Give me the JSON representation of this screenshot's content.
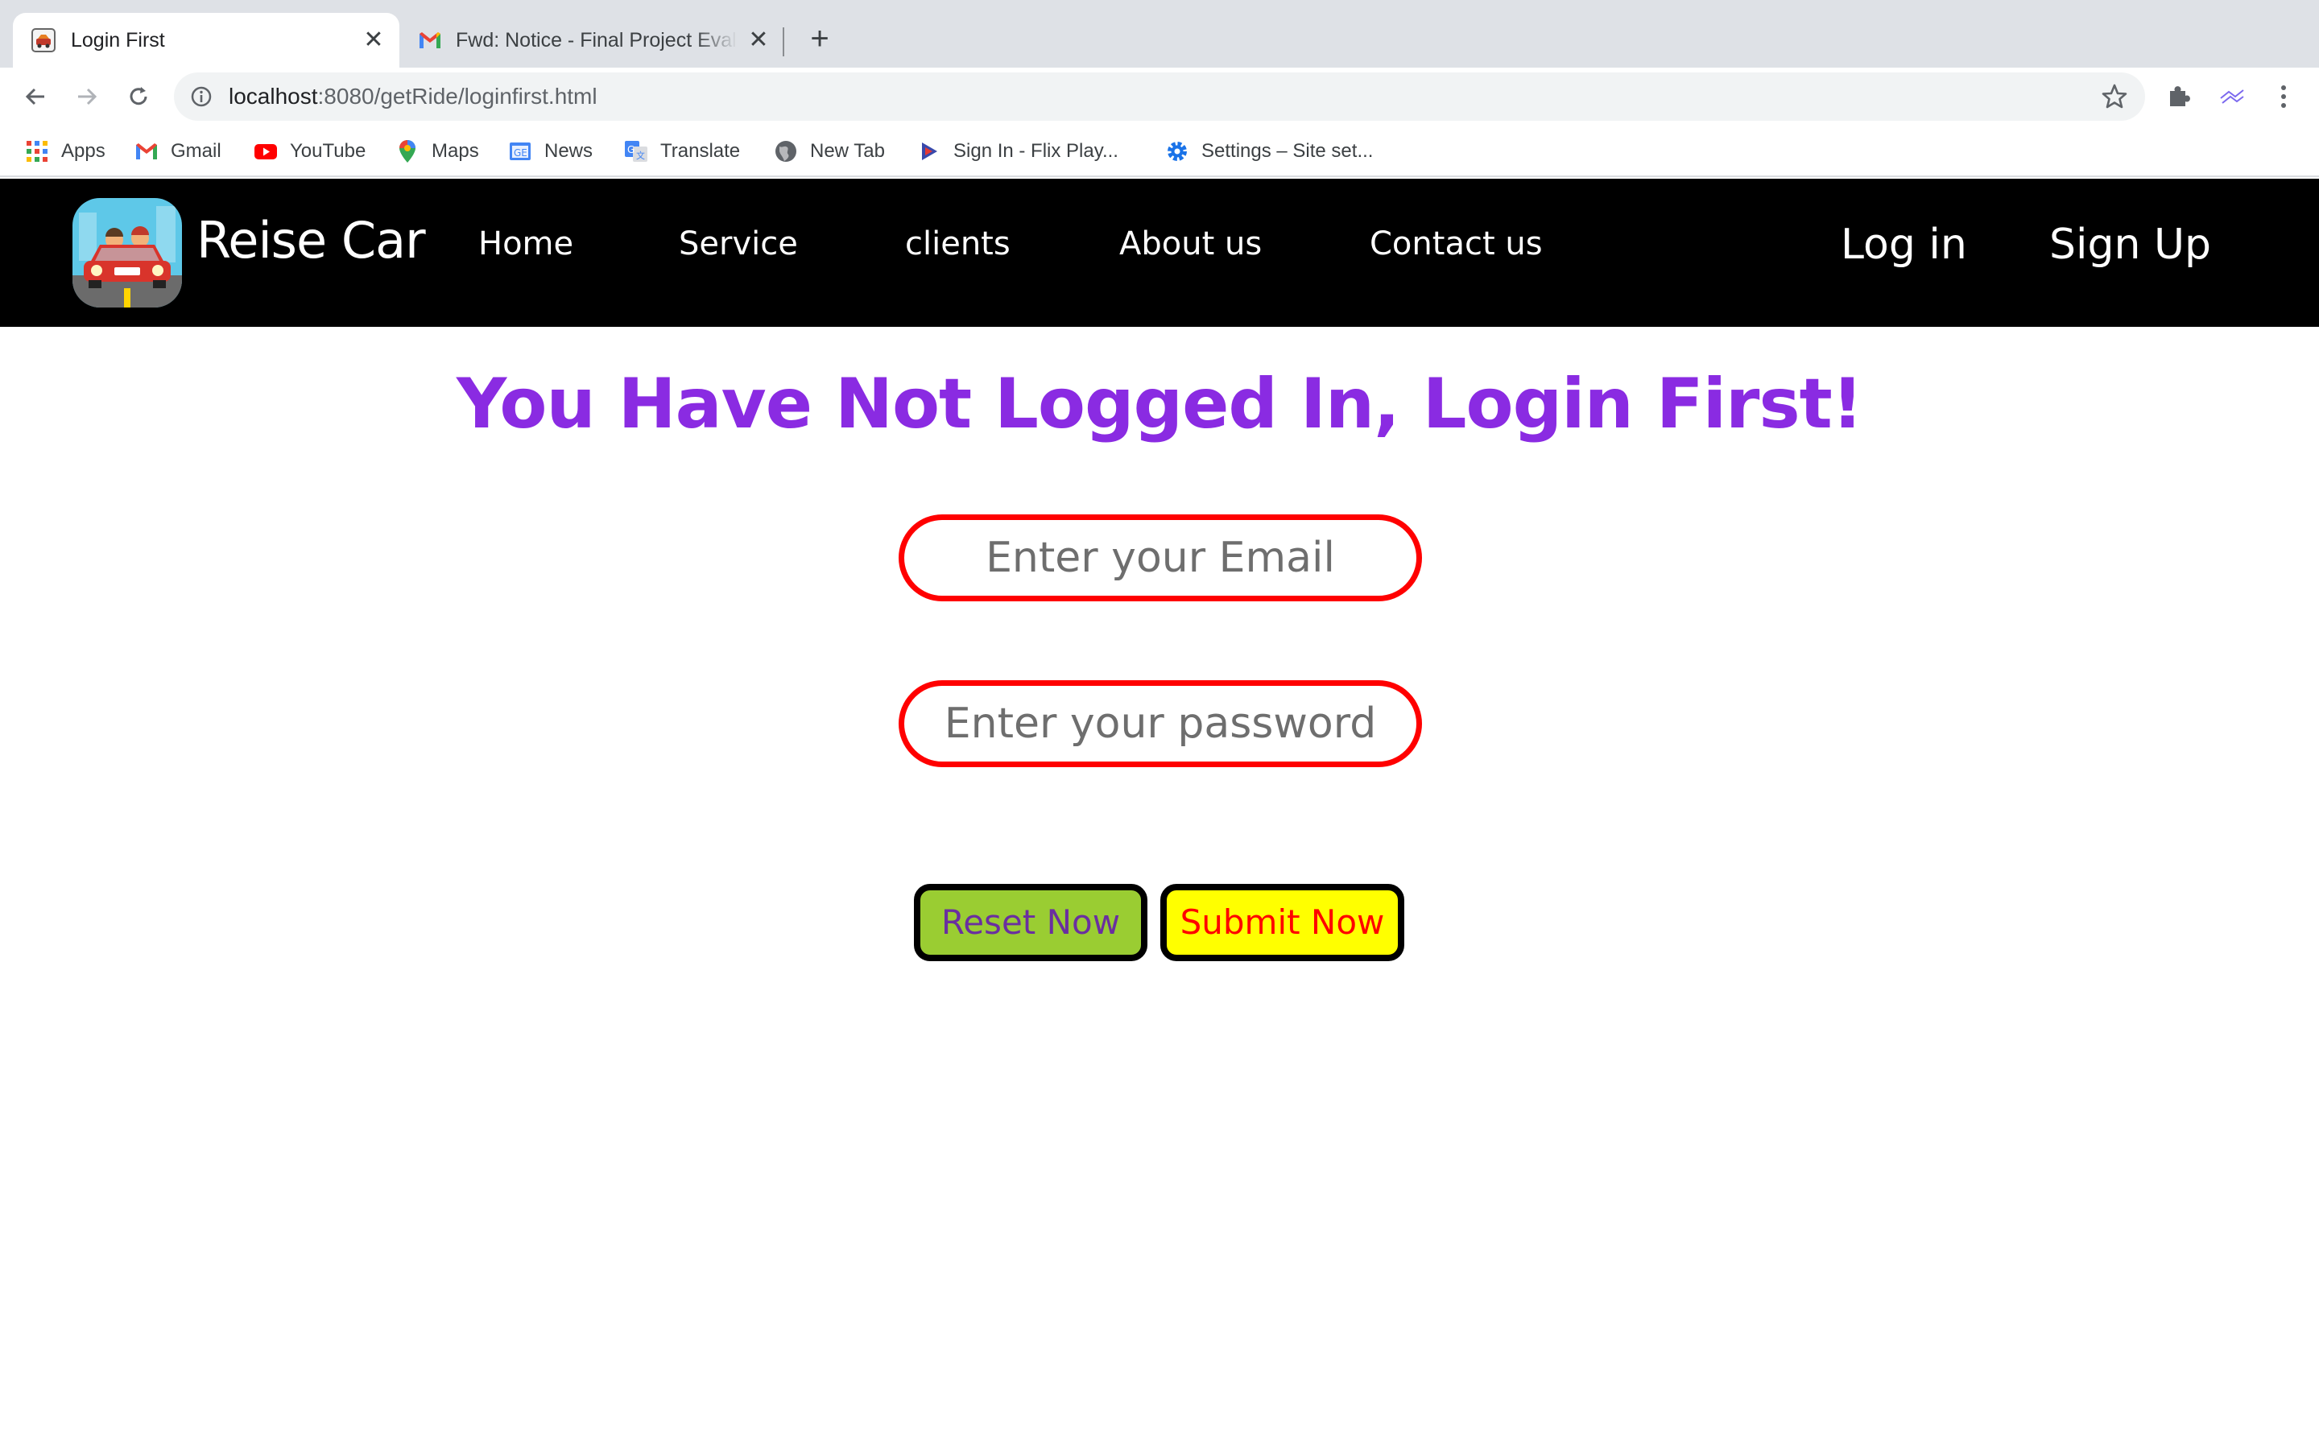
{
  "browser": {
    "tabs": [
      {
        "title": "Login First",
        "active": true,
        "favicon": "car-logo-icon"
      },
      {
        "title": "Fwd: Notice - Final Project Evaluation",
        "active": false,
        "favicon": "gmail-icon"
      }
    ],
    "url_host": "localhost",
    "url_path": ":8080/getRide/loginfirst.html",
    "bookmarks": [
      {
        "label": "Apps",
        "icon": "apps-grid-icon"
      },
      {
        "label": "Gmail",
        "icon": "gmail-icon"
      },
      {
        "label": "YouTube",
        "icon": "youtube-icon"
      },
      {
        "label": "Maps",
        "icon": "maps-pin-icon"
      },
      {
        "label": "News",
        "icon": "google-news-icon"
      },
      {
        "label": "Translate",
        "icon": "google-translate-icon"
      },
      {
        "label": "New Tab",
        "icon": "globe-icon"
      },
      {
        "label": "Sign In - Flix Play...",
        "icon": "flix-play-icon"
      },
      {
        "label": "Settings – Site set...",
        "icon": "gear-icon"
      }
    ]
  },
  "site": {
    "brand": "Reise Car",
    "nav": [
      "Home",
      "Service",
      "clients",
      "About us",
      "Contact us"
    ],
    "login": "Log in",
    "signup": "Sign Up"
  },
  "main": {
    "heading": "You Have Not Logged In, Login First!",
    "email_placeholder": "Enter your Email",
    "password_placeholder": "Enter your password",
    "reset_label": "Reset Now",
    "submit_label": "Submit Now"
  },
  "colors": {
    "heading": "#8a2be2",
    "field_border": "#ff0000",
    "reset_bg": "#9acd32",
    "reset_text": "#6a2fa0",
    "submit_bg": "#ffff00",
    "submit_text": "#ff0000",
    "nav_bg": "#000000"
  }
}
